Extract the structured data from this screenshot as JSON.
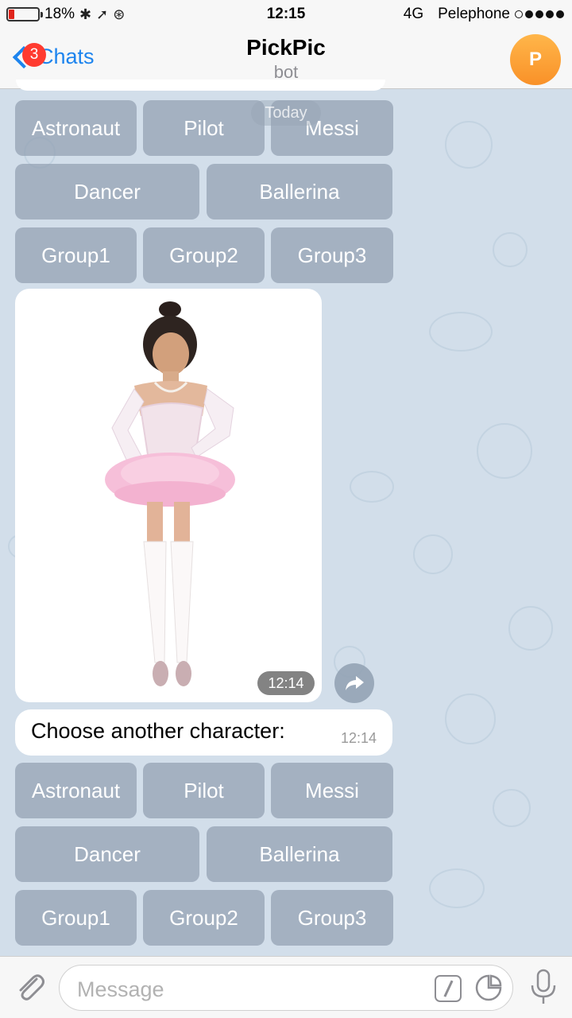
{
  "status_bar": {
    "battery": "18%",
    "battery_level": 0.18,
    "time": "12:15",
    "network": "4G",
    "carrier": "Pelephone"
  },
  "nav": {
    "back_label": "Chats",
    "unread_badge": "3",
    "title": "PickPic",
    "subtitle": "bot",
    "avatar_letter": "P"
  },
  "date_divider": "Today",
  "keyboard_top": {
    "row1": [
      "Astronaut",
      "Pilot",
      "Messi"
    ],
    "row2": [
      "Dancer",
      "Ballerina"
    ],
    "row3": [
      "Group1",
      "Group2",
      "Group3"
    ]
  },
  "photo_message": {
    "time": "12:14"
  },
  "text_message": {
    "text": "Choose another character:",
    "time": "12:14"
  },
  "keyboard_bottom": {
    "row1": [
      "Astronaut",
      "Pilot",
      "Messi"
    ],
    "row2": [
      "Dancer",
      "Ballerina"
    ],
    "row3": [
      "Group1",
      "Group2",
      "Group3"
    ]
  },
  "input": {
    "placeholder": "Message"
  },
  "colors": {
    "accent": "#1d84ee",
    "badge": "#ff3b30",
    "avatar": "#f99128",
    "button": "#91a0b1"
  }
}
